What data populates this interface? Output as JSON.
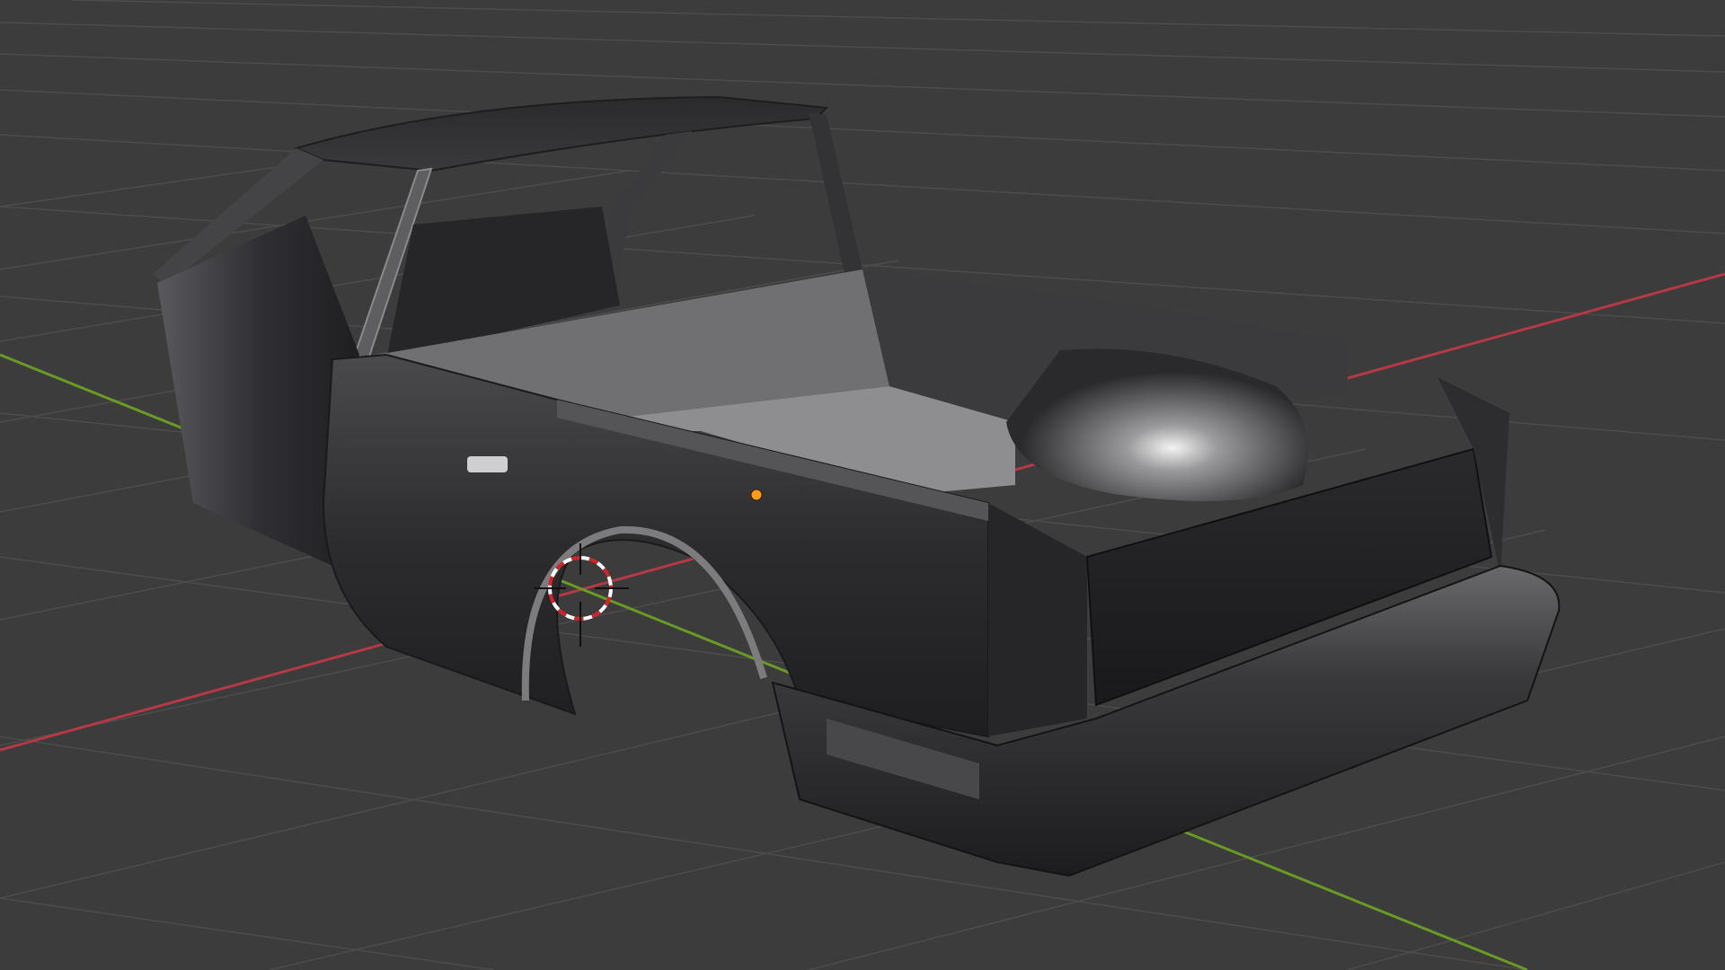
{
  "viewport": {
    "name": "3D Viewport",
    "background": "#3c3c3c",
    "grid_color": "#4a4a4a",
    "x_axis_color": "#b53846",
    "y_axis_color": "#6a9a25"
  },
  "scene": {
    "object": "pickup-car-body",
    "body_color": "#2f2f31",
    "bed_color": "#6b6b6b",
    "origin_color": "#ff9a1a",
    "cursor_colors": [
      "#d8222a",
      "#ffffff"
    ]
  }
}
